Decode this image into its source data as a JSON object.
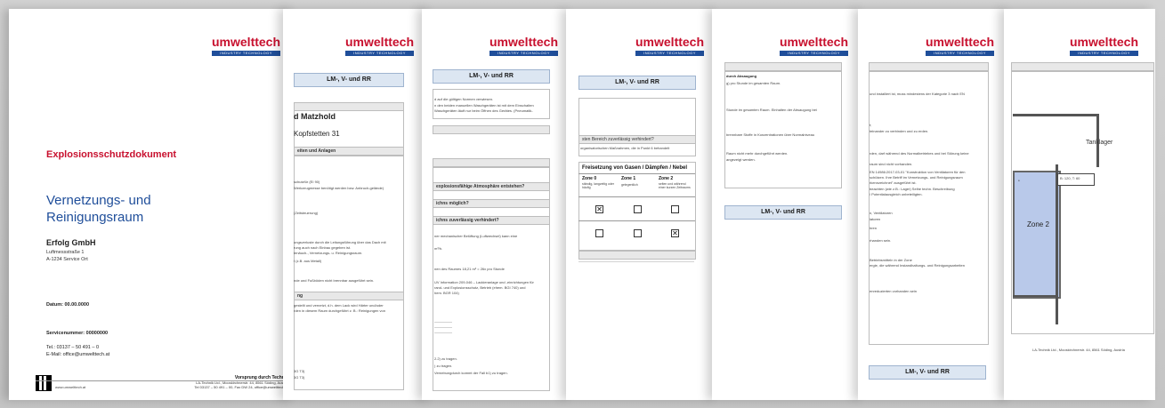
{
  "brand": {
    "name": "umwelttech",
    "tagline": "INDUSTRY TECHNOLOGY"
  },
  "cover": {
    "title": "Explosionsschutzdokument",
    "subtitle": "Vernetzungs- und Reinigungsraum",
    "company": "Erfolg GmbH",
    "street": "Luftmessstraße 1",
    "city": "A-1234 Service Ort",
    "date": "Datum: 00.00.0000",
    "service_number": "Servicenummer: 00000000",
    "phone": "Tel.: 03137 – 50 491 – 0",
    "email": "E-Mail: office@umwelttech.at",
    "website": "www.umwelttech.at",
    "footer_title": "Vorsprung durch Technik",
    "footer_line1": "LA-Technik Ltd., Mooskirchnerstr. 44, 8561 Söding, Austria",
    "footer_line2": "Tel 03137 – 50 491 – 00, Fax DW 24, office@umwelttech.at"
  },
  "section_title": "LM-, V- und RR",
  "page2": {
    "name_heading": "d Matzhold",
    "address": "Kopfstetten 31",
    "section": "eiten und Anlagen",
    "lines": [
      "schutzfür (EI 90)",
      "Werkzeugmesse benötigt werden bzw. Anbruch-gelände)",
      "(Zeitsteuerung)",
      "ungsverluste durch die Leitungsführung über das Dach mit",
      "rung auch nach Einbau gegeben ist.",
      "tenäuch-, Vernetzungs- u. Reinigungsraum.",
      "t (z.B. aus Metall)",
      "nde und Fußböden nicht brennbar ausgeführt sein.",
      "ng",
      "gestellt und vernetzt, d.h. dem Lack wird Härter und/oder",
      "rden in diesem Raum durchgeführt z. B.: Reinigungen von",
      "3G T3)",
      "3G T3)"
    ]
  },
  "page3": {
    "lines": [
      "d auf die gültigen Normen verwiesen.",
      "n den beiden manuellen Waschgeräten ist mit dem Einschalten",
      "Waschgeräten läuft nur beim Öffnen des Gerätes. (Pneumatik-",
      "explosionsfähige Atmosphäre entstehen?",
      "ichns möglich?",
      "ichns zuverlässig verhindert?",
      "ner mechanischer Belüftung (Luftwechsel) kann eine",
      "m³/h.",
      "nen des Raumes 18,21 m³ = 26x pro Stunde",
      "UV Information 209-046 – Lackieranlage und -einrichtungen für",
      "rand- und Explosionsschutz, Betrieb (ehem. BGI 740) und",
      "hem. BGR 104)",
      "2.2) zu tragen.",
      ") zu tragen.",
      "Vernebungdurch kommt der Fall b1) zu tragen."
    ]
  },
  "page4": {
    "line1": "sten Bereich zuverlässig verhindert?",
    "line2": "organisatorischen Maßnahmen, die in Punkt 6 behandelt",
    "table_title": "Freisetzung von Gasen / Dämpfen / Nebel",
    "zones": [
      {
        "name": "Zone 0",
        "desc": "ständig, langzeitig oder häufig"
      },
      {
        "name": "Zone 1",
        "desc": "gelegentlich"
      },
      {
        "name": "Zone 2",
        "desc": "selten und während einer kurzen Zeitraums"
      }
    ],
    "checks": [
      [
        true,
        false,
        false
      ],
      [
        false,
        false,
        true
      ]
    ]
  },
  "page5": {
    "heading": "durch Absaugung",
    "lines": [
      "g) pro Stunde im gesamten Raum.",
      "Stunde im gesamten Raum. Einhalten der Absaugung bei",
      "brennbare Stoffe in Konzentrationen über Normalniveau",
      "Raum nicht mehr durchgeführt werden.",
      "angezeigt werden."
    ]
  },
  "page6": {
    "lines": [
      "und installiert ist, muss mindestens der Kategorie 3 nach EN",
      "t;",
      "teinander zu verbinden und zu erden.",
      "rden, darf während des Normalbetriebes und bei Störung keine",
      "raum sind nicht vorhanden.",
      "EN 14986:2017-03-01 \"Konstruktion von Ventilatoren für den",
      "schützen. Ihre Betriff im Vernetzungs- und Reinigungsraum",
      "rkennzeichnet\" ausgeführt ist.",
      "beachten (wie z.B.: Lager) Seihe techn. Beschreibung",
      "/ Potentialausgleich unbeteiligten.",
      "n, Ventilatoren",
      "latoren",
      "hren",
      "rhanden sein.",
      "Betriebsmitteln in der Zone",
      "ergie, die während Instandhaltungs- und Reinigungsarbeiten",
      "enreduzierten vorhanden sein"
    ]
  },
  "page7": {
    "room_label": "Tanklager",
    "zone_label": "Zone 2",
    "callout": "B: 120, T: 60",
    "footer": "LA-Technik Ltd., Mooskirchnerstr. 44, 8561 Söding, Austria"
  },
  "colors": {
    "brand_red": "#c8102e",
    "brand_blue": "#1f4e9a",
    "header_fill": "#dce6f2",
    "zone_fill": "#b9c9ea"
  }
}
